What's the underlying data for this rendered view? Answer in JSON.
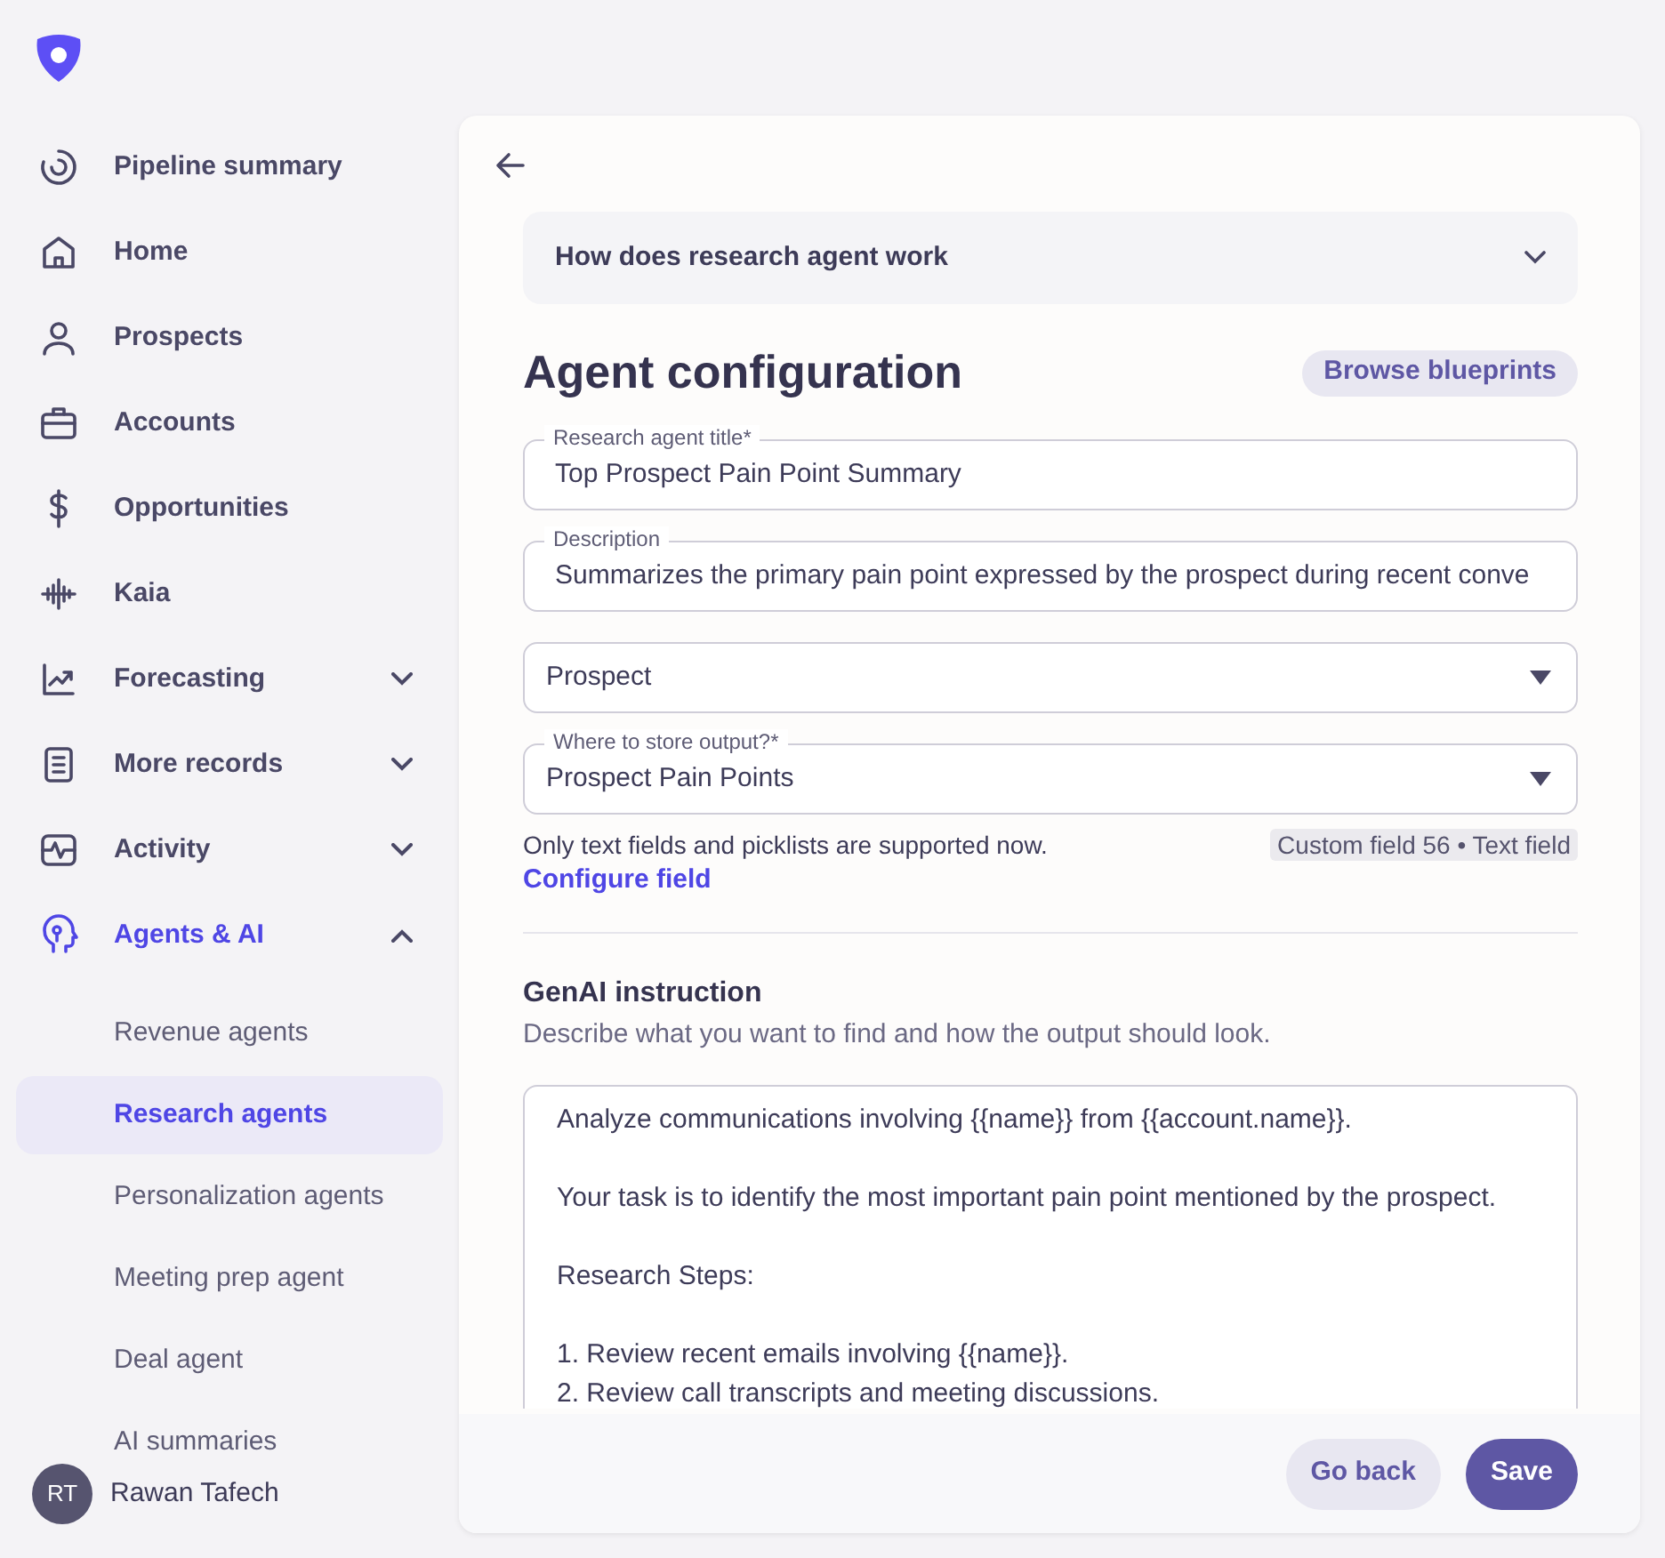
{
  "sidebar": {
    "items": [
      {
        "label": "Pipeline summary",
        "kind": "link",
        "selected": false
      },
      {
        "label": "Home",
        "kind": "link",
        "selected": false
      },
      {
        "label": "Prospects",
        "kind": "link",
        "selected": false
      },
      {
        "label": "Accounts",
        "kind": "link",
        "selected": false
      },
      {
        "label": "Opportunities",
        "kind": "link",
        "selected": false
      },
      {
        "label": "Kaia",
        "kind": "link",
        "selected": false
      },
      {
        "label": "Forecasting",
        "kind": "group",
        "selected": false,
        "expanded": false
      },
      {
        "label": "More records",
        "kind": "group",
        "selected": false,
        "expanded": false
      },
      {
        "label": "Activity",
        "kind": "group",
        "selected": false,
        "expanded": false
      },
      {
        "label": "Agents & AI",
        "kind": "group",
        "selected": true,
        "expanded": true,
        "children": [
          {
            "label": "Revenue agents",
            "selected": false
          },
          {
            "label": "Research agents",
            "selected": true
          },
          {
            "label": "Personalization agents",
            "selected": false
          },
          {
            "label": "Meeting prep agent",
            "selected": false
          },
          {
            "label": "Deal agent",
            "selected": false
          },
          {
            "label": "AI summaries",
            "selected": false
          }
        ]
      }
    ],
    "user": {
      "initials": "RT",
      "name": "Rawan Tafech"
    }
  },
  "main": {
    "accordion": {
      "title": "How does research agent work",
      "expanded": false
    },
    "heading": "Agent configuration",
    "browse_button": "Browse blueprints",
    "fields": [
      {
        "kind": "text",
        "label": "Research agent title*",
        "value": "Top Prospect Pain Point Summary"
      },
      {
        "kind": "text",
        "label": "Description",
        "value": "Summarizes the primary pain point expressed by the prospect during recent conve"
      },
      {
        "kind": "select",
        "value": "Prospect"
      },
      {
        "kind": "select",
        "label": "Where to store output?*",
        "value": "Prospect Pain Points"
      }
    ],
    "helper_text": "Only text fields and picklists are supported now.",
    "field_tag": "Custom field 56 • Text field",
    "configure_link": "Configure field",
    "genai": {
      "heading": "GenAI instruction",
      "description": "Describe what you want to find and how the output should look.",
      "paragraphs": [
        [
          "Analyze communications involving {{name}} from {{account.name}}."
        ],
        [
          "Your task is to identify the most important pain point mentioned by the prospect."
        ],
        [
          "Research Steps:"
        ],
        [
          "1. Review recent emails involving {{name}}.",
          "2. Review call transcripts and meeting discussions."
        ]
      ]
    },
    "footer": {
      "buttons": [
        {
          "label": "Go back",
          "kind": "secondary"
        },
        {
          "label": "Save",
          "kind": "primary"
        }
      ]
    }
  }
}
